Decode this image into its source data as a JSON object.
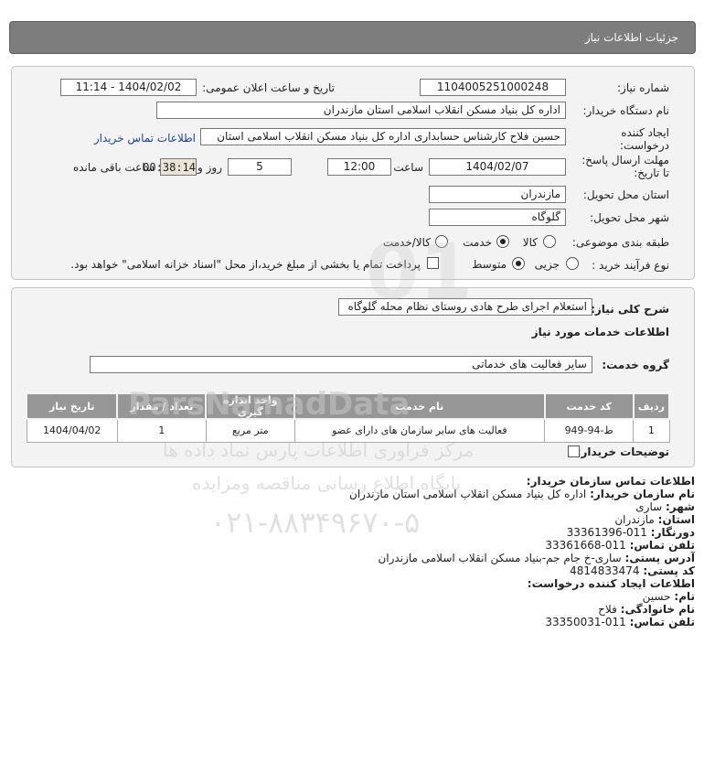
{
  "header": {
    "title": "جزئیات اطلاعات نیاز"
  },
  "form": {
    "need_number_label": "شماره نیاز:",
    "need_number": "1104005251000248",
    "announce_label": "تاریخ و ساعت اعلان عمومی:",
    "announce_value": "1404/02/02 - 11:14",
    "buyer_org_label": "نام دستگاه خریدار:",
    "buyer_org": "اداره کل بنیاد مسکن انقلاب اسلامی استان مازندران",
    "creator_label_1": "ایجاد کننده",
    "creator_label_2": "درخواست:",
    "creator": "حسین فلاح کارشناس حسابداری اداره کل بنیاد مسکن انقلاب اسلامی استان",
    "buyer_contact_link": "اطلاعات تماس خریدار",
    "deadline_label_1": "مهلت ارسال پاسخ:",
    "deadline_label_2": "تا تاریخ:",
    "deadline_date": "1404/02/07",
    "time_label": "ساعت",
    "deadline_time": "12:00",
    "days_value": "5",
    "days_label": "روز و",
    "remaining_time": "00:38:14",
    "remaining_label": "ساعت باقی مانده",
    "province_label": "استان محل تحویل:",
    "province": "مازندران",
    "city_label": "شهر محل تحویل:",
    "city": "گلوگاه",
    "category_label": "طبقه بندی موضوعی:",
    "category_options": [
      "کالا",
      "خدمت",
      "کالا/خدمت"
    ],
    "category_selected": "خدمت",
    "process_label": "نوع فرآیند خرید :",
    "process_options": [
      "جزیی",
      "متوسط"
    ],
    "process_selected": "متوسط",
    "payment_note": "پرداخت تمام یا بخشی از مبلغ خرید،از محل \"اسناد خزانه اسلامی\" خواهد بود."
  },
  "description": {
    "label": "شرح کلی نیاز:",
    "value": "استعلام اجرای طرح هادی روستای نظام محله گلوگاه",
    "services_heading": "اطلاعات خدمات مورد نیاز",
    "service_group_label": "گروه خدمت:",
    "service_group": "سایر فعالیت های خدماتی"
  },
  "table": {
    "headers": [
      "ردیف",
      "کد خدمت",
      "نام خدمت",
      "واحد اندازه گیری",
      "تعداد / مقدار",
      "تاریخ نیاز"
    ],
    "rows": [
      [
        "1",
        "ط-94-949",
        "فعالیت های سایر سازمان های دارای عضو",
        "متر مربع",
        "1",
        "1404/04/02"
      ]
    ]
  },
  "buyer_notes_label": "توضیحات خریدار:",
  "contact": {
    "heading": "اطلاعات تماس سازمان خریدار:",
    "org_label": "نام سازمان خریدار:",
    "org_value": "اداره کل بنیاد مسکن انقلاب اسلامی استان مازندران",
    "city_label": "شهر:",
    "city_value": "ساری",
    "province_label": "استان:",
    "province_value": "مازندران",
    "fax_label": "دورنگار:",
    "fax_value": "011-33361396",
    "phone_label": "تلفن تماس:",
    "phone_value": "011-33361668",
    "address_label": "آدرس پستی:",
    "address_value": "ساری-خ جام جم-بنیاد مسکن انقلاب اسلامی مازندران",
    "postal_label": "کد پستی:",
    "postal_value": "4814833474",
    "creator_heading": "اطلاعات ایجاد کننده درخواست:",
    "first_name_label": "نام:",
    "first_name_value": "حسین",
    "last_name_label": "نام خانوادگی:",
    "last_name_value": "فلاح",
    "creator_phone_label": "تلفن تماس:",
    "creator_phone_value": "011-33350031"
  },
  "watermark": {
    "brand": "ParsNamadData",
    "line1": "مرکز فراوری اطلاعات پارس نماد داده ها",
    "line2": "پایگاه اطلاع رسانی مناقصه ومزایده",
    "phone": "۰۲۱-۸۸۳۴۹۶۷۰-۵"
  }
}
